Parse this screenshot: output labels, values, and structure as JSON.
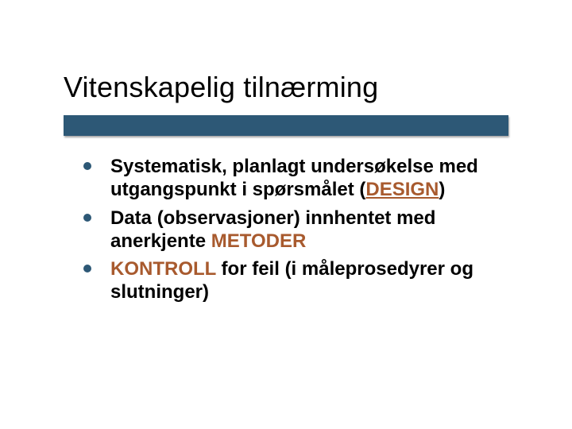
{
  "slide": {
    "title": "Vitenskapelig tilnærming",
    "bullets": [
      {
        "pre": "Systematisk, planlagt undersøkelse med utgangspunkt i spørsmålet (",
        "emph": "DESIGN",
        "emph_class": "emph1",
        "post": ")"
      },
      {
        "pre": "Data (observasjoner) innhentet med anerkjente ",
        "emph": "METODER",
        "emph_class": "emph2",
        "post": ""
      },
      {
        "pre": "",
        "emph": "KONTROLL",
        "emph_class": "emph2",
        "post": " for feil (i måleprosedyrer og slutninger)"
      }
    ]
  }
}
